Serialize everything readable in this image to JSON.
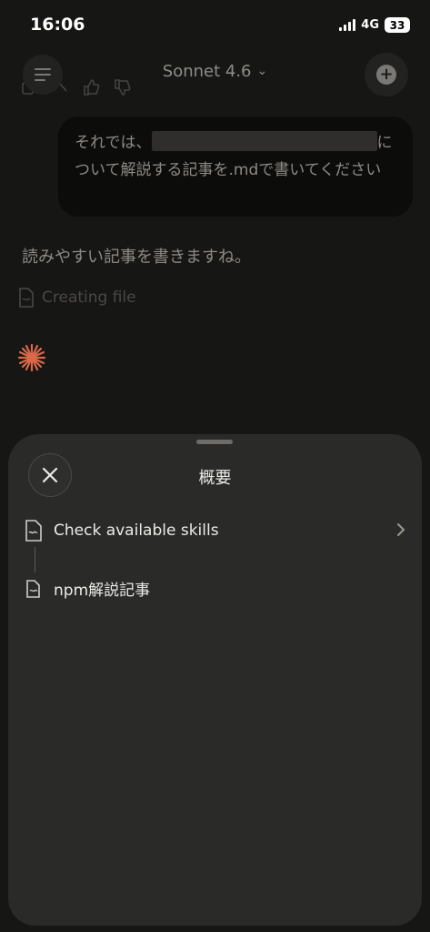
{
  "status_bar": {
    "time": "16:06",
    "network": "4G",
    "battery": "33"
  },
  "header": {
    "model_name": "Sonnet 4.6"
  },
  "conversation": {
    "user_message_before": "それでは、",
    "user_message_after": "について解説する記事を.mdで書いてください",
    "assistant_reply": "読みやすい記事を書きますね。",
    "tool_status": "Creating file"
  },
  "sheet": {
    "title": "概要",
    "items": [
      {
        "label": "Check available skills",
        "has_chevron": true
      },
      {
        "label": "npm解説記事",
        "has_chevron": false
      }
    ]
  },
  "colors": {
    "sheet_bg": "#2a2a28",
    "accent_spark": "#d9694a"
  }
}
